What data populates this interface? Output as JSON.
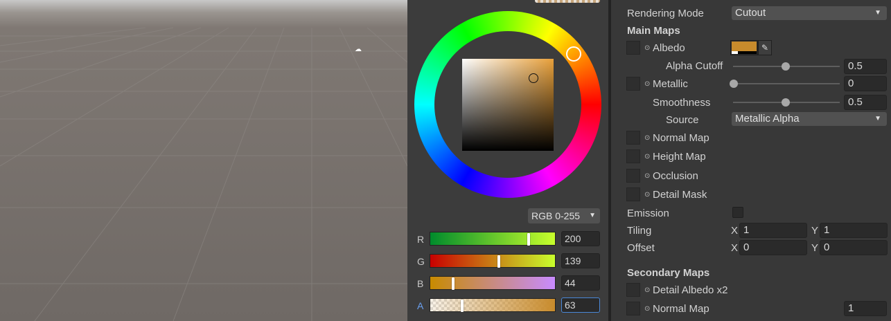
{
  "color_picker": {
    "mode": "RGB 0-255",
    "channels": [
      {
        "label": "R",
        "value": "200",
        "level": 200,
        "gradient": "linear-gradient(90deg,#008b2c,#c8ff2c)"
      },
      {
        "label": "G",
        "value": "139",
        "level": 139,
        "gradient": "linear-gradient(90deg,#c80000,#c8ff2c)"
      },
      {
        "label": "B",
        "value": "44",
        "level": 44,
        "gradient": "linear-gradient(90deg,#c88b00,#c88bff)"
      },
      {
        "label": "A",
        "value": "63",
        "level": 63,
        "gradient": "linear-gradient(90deg,rgba(200,139,44,0.1),#c88b2c)"
      }
    ],
    "hue_color": "#e8a03a"
  },
  "inspector": {
    "rendering_mode_label": "Rendering Mode",
    "rendering_mode_value": "Cutout",
    "main_maps": "Main Maps",
    "albedo": "Albedo",
    "albedo_color": "#c88b2c",
    "alpha_cutoff_label": "Alpha Cutoff",
    "alpha_cutoff_value": "0.5",
    "metallic": "Metallic",
    "metallic_value": "0",
    "smoothness_label": "Smoothness",
    "smoothness_value": "0.5",
    "source_label": "Source",
    "source_value": "Metallic Alpha",
    "normal_map": "Normal Map",
    "height_map": "Height Map",
    "occlusion": "Occlusion",
    "detail_mask": "Detail Mask",
    "emission": "Emission",
    "tiling": "Tiling",
    "offset": "Offset",
    "x": "X",
    "y": "Y",
    "tiling_x": "1",
    "tiling_y": "1",
    "offset_x": "0",
    "offset_y": "0",
    "secondary_maps": "Secondary Maps",
    "detail_albedo": "Detail Albedo x2",
    "secondary_normal_map": "Normal Map",
    "secondary_normal_value": "1"
  }
}
